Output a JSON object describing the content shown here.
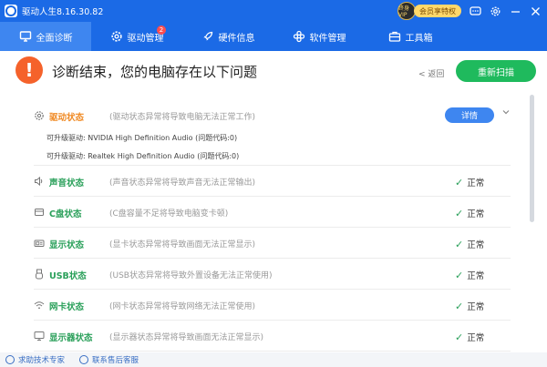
{
  "titlebar": {
    "title": "驱动人生8.16.30.82",
    "vip_avatar_text": "终身VIP",
    "vip_label": "会员享特权"
  },
  "nav": {
    "tabs": [
      {
        "label": "全面诊断",
        "icon": "monitor-icon",
        "active": true
      },
      {
        "label": "驱动管理",
        "icon": "gear-icon",
        "badge": "2"
      },
      {
        "label": "硬件信息",
        "icon": "rocket-icon"
      },
      {
        "label": "软件管理",
        "icon": "apps-icon"
      },
      {
        "label": "工具箱",
        "icon": "toolbox-icon"
      }
    ]
  },
  "header": {
    "title": "诊断结束，您的电脑存在以下问题",
    "back_label": "< 返回",
    "rescan_label": "重新扫描"
  },
  "rows": [
    {
      "label": "驱动状态",
      "icon": "gear-icon",
      "desc": "(驱动状态异常将导致电脑无法正常工作)",
      "detail_label": "详情",
      "subs": [
        "可升级驱动: NVIDIA High Definition Audio (问题代码:0)",
        "可升级驱动: Realtek High Definition Audio (问题代码:0)"
      ]
    },
    {
      "label": "声音状态",
      "icon": "speaker-icon",
      "desc": "(声音状态异常将导致声音无法正常输出)",
      "status": "正常"
    },
    {
      "label": "C盘状态",
      "icon": "disk-icon",
      "desc": "(C盘容量不足将导致电脑变卡顿)",
      "status": "正常"
    },
    {
      "label": "显示状态",
      "icon": "display-card-icon",
      "desc": "(显卡状态异常将导致画面无法正常显示)",
      "status": "正常"
    },
    {
      "label": "USB状态",
      "icon": "usb-icon",
      "desc": "(USB状态异常将导致外置设备无法正常使用)",
      "status": "正常"
    },
    {
      "label": "网卡状态",
      "icon": "wifi-icon",
      "desc": "(网卡状态异常将导致网络无法正常使用)",
      "status": "正常"
    },
    {
      "label": "显示器状态",
      "icon": "monitor-icon",
      "desc": "(显示器状态异常将导致画面无法正常显示)",
      "status": "正常"
    }
  ],
  "footer": {
    "expert_label": "求助技术专家",
    "support_label": "联系售后客服"
  },
  "colors": {
    "primary": "#1b6ae6",
    "green": "#1fba5d",
    "warning": "#f5622b",
    "orange_label": "#f08a24"
  }
}
